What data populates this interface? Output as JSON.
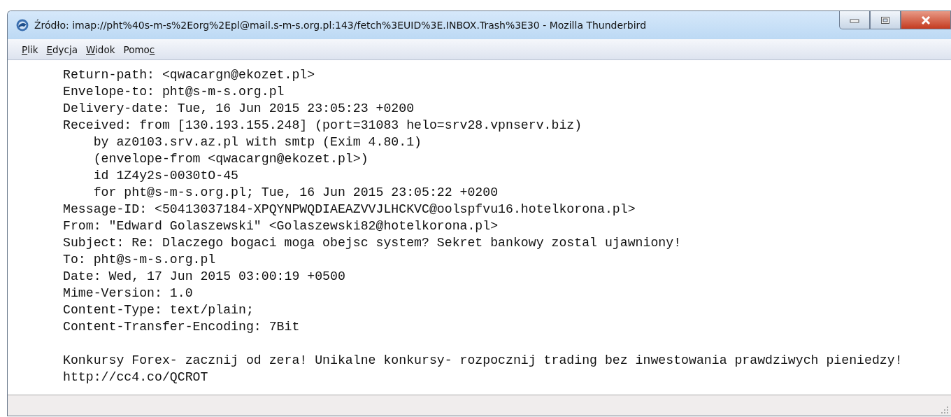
{
  "window": {
    "title": "Źródło: imap://pht%40s-m-s%2Eorg%2Epl@mail.s-m-s.org.pl:143/fetch%3EUID%3E.INBOX.Trash%3E30 - Mozilla Thunderbird"
  },
  "menu": [
    {
      "key": "P",
      "after": "lik"
    },
    {
      "key": "E",
      "after": "dycja"
    },
    {
      "key": "W",
      "after": "idok"
    },
    {
      "before": "Pomo",
      "key": "c"
    }
  ],
  "headers": [
    "Return-path: <qwacargn@ekozet.pl>",
    "Envelope-to: pht@s-m-s.org.pl",
    "Delivery-date: Tue, 16 Jun 2015 23:05:23 +0200",
    "Received: from [130.193.155.248] (port=31083 helo=srv28.vpnserv.biz)",
    "    by az0103.srv.az.pl with smtp (Exim 4.80.1)",
    "    (envelope-from <qwacargn@ekozet.pl>)",
    "    id 1Z4y2s-0030tO-45",
    "    for pht@s-m-s.org.pl; Tue, 16 Jun 2015 23:05:22 +0200",
    "Message-ID: <50413037184-XPQYNPWQDIAEAZVVJLHCKVC@oolspfvu16.hotelkorona.pl>",
    "From: \"Edward Golaszewski\" <Golaszewski82@hotelkorona.pl>",
    "Subject: Re: Dlaczego bogaci moga obejsc system? Sekret bankowy zostal ujawniony!",
    "To: pht@s-m-s.org.pl",
    "Date: Wed, 17 Jun 2015 03:00:19 +0500",
    "Mime-Version: 1.0",
    "Content-Type: text/plain;",
    "Content-Transfer-Encoding: 7Bit"
  ],
  "body": [
    "Konkursy Forex- zacznij od zera! Unikalne konkursy- rozpocznij trading bez inwestowania prawdziwych pieniedzy!",
    "http://cc4.co/QCROT"
  ]
}
